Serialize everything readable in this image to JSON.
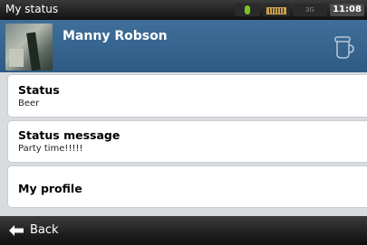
{
  "statusbar": {
    "title": "My status",
    "signal_label": "3G",
    "clock": "11:08"
  },
  "header": {
    "username": "Manny Robson",
    "avatar_icon": "user-photo",
    "status_icon": "cup-icon"
  },
  "items": {
    "status": {
      "label": "Status",
      "value": "Beer"
    },
    "status_message": {
      "label": "Status message",
      "value": "Party time!!!!!"
    },
    "profile": {
      "label": "My profile"
    }
  },
  "footer": {
    "back_label": "Back",
    "back_icon": "arrow-left-icon"
  },
  "colors": {
    "header_blue": "#2e5b84",
    "page_bg": "#d9dcdf"
  }
}
